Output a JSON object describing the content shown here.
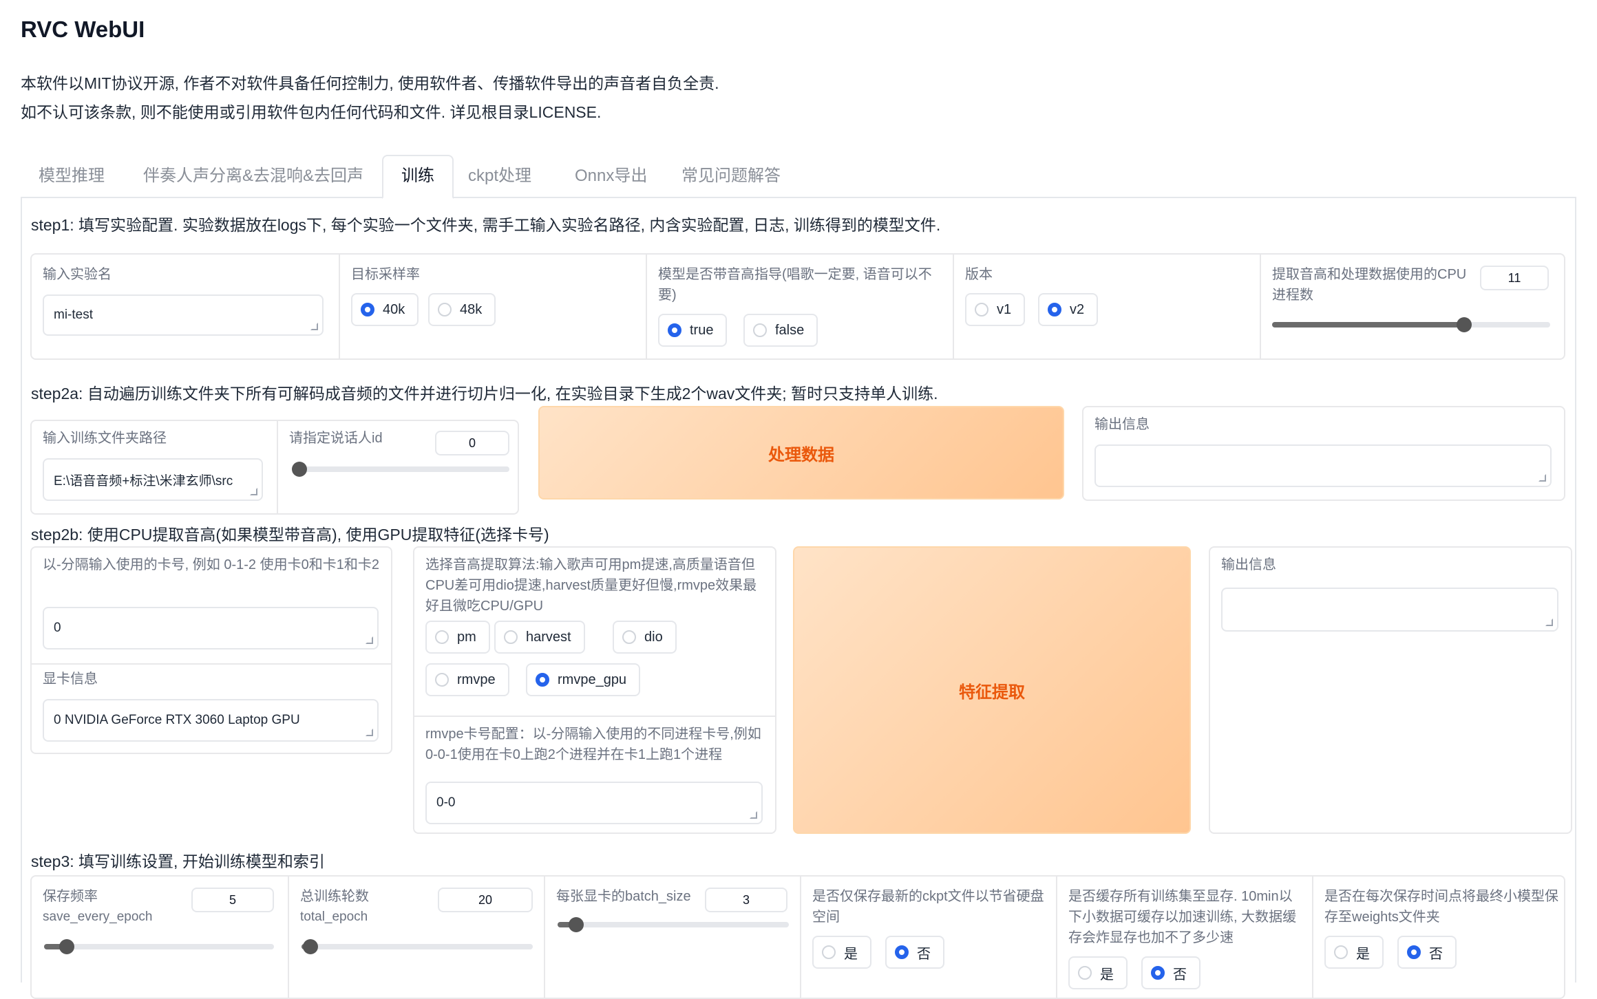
{
  "app": {
    "title": "RVC WebUI",
    "notice": [
      "本软件以MIT协议开源, 作者不对软件具备任何控制力, 使用软件者、传播软件导出的声音者自负全责.",
      "如不认可该条款, 则不能使用或引用软件包内任何代码和文件. 详见根目录LICENSE."
    ]
  },
  "tabs": [
    "模型推理",
    "伴奏人声分离&去混响&去回声",
    "训练",
    "ckpt处理",
    "Onnx导出",
    "常见问题解答"
  ],
  "active_tab": "训练",
  "step1": {
    "heading": "step1: 填写实验配置. 实验数据放在logs下, 每个实验一个文件夹, 需手工输入实验名路径, 内含实验配置, 日志, 训练得到的模型文件.",
    "exp_name_label": "输入实验名",
    "exp_name_value": "mi-test",
    "sr_label": "目标采样率",
    "sr_options": [
      "40k",
      "48k"
    ],
    "sr_selected": "40k",
    "f0_label": "模型是否带音高指导(唱歌一定要, 语音可以不要)",
    "f0_options": [
      "true",
      "false"
    ],
    "f0_selected": "true",
    "version_label": "版本",
    "version_options": [
      "v1",
      "v2"
    ],
    "version_selected": "v2",
    "cpu_label": "提取音高和处理数据使用的CPU进程数",
    "cpu_value": "11",
    "cpu_fraction": 0.69
  },
  "step2a": {
    "heading": "step2a: 自动遍历训练文件夹下所有可解码成音频的文件并进行切片归一化, 在实验目录下生成2个wav文件夹; 暂时只支持单人训练.",
    "folder_label": "输入训练文件夹路径",
    "folder_value": "E:\\语音音频+标注\\米津玄师\\src",
    "speaker_label": "请指定说话人id",
    "speaker_value": "0",
    "speaker_fraction": 0.0,
    "process_button": "处理数据",
    "output_label": "输出信息",
    "output_value": ""
  },
  "step2b": {
    "heading": "step2b: 使用CPU提取音高(如果模型带音高), 使用GPU提取特征(选择卡号)",
    "gpus_label": "以-分隔输入使用的卡号, 例如 0-1-2 使用卡0和卡1和卡2",
    "gpus_value": "0",
    "gpu_info_label": "显卡信息",
    "gpu_info_value": "0  NVIDIA GeForce RTX 3060 Laptop GPU",
    "f0_method_label": "选择音高提取算法:输入歌声可用pm提速,高质量语音但CPU差可用dio提速,harvest质量更好但慢,rmvpe效果最好且微吃CPU/GPU",
    "f0_methods": [
      "pm",
      "harvest",
      "dio",
      "rmvpe",
      "rmvpe_gpu"
    ],
    "f0_method_selected": "rmvpe_gpu",
    "rmvpe_label": "rmvpe卡号配置：以-分隔输入使用的不同进程卡号,例如0-0-1使用在卡0上跑2个进程并在卡1上跑1个进程",
    "rmvpe_value": "0-0",
    "extract_button": "特征提取",
    "output_label": "输出信息",
    "output_value": ""
  },
  "step3": {
    "heading": "step3: 填写训练设置, 开始训练模型和索引",
    "save_freq_label": "保存频率",
    "save_freq_sub": "save_every_epoch",
    "save_freq_value": "5",
    "save_freq_fraction": 0.1,
    "epochs_label": "总训练轮数",
    "epochs_sub": "total_epoch",
    "epochs_value": "20",
    "epochs_fraction": 0.04,
    "batch_label": "每张显卡的batch_size",
    "batch_value": "3",
    "batch_fraction": 0.08,
    "latest_label": "是否仅保存最新的ckpt文件以节省硬盘空间",
    "latest_options": [
      "是",
      "否"
    ],
    "latest_selected": "否",
    "cache_label": "是否缓存所有训练集至显存. 10min以下小数据可缓存以加速训练, 大数据缓存会炸显存也加不了多少速",
    "cache_options": [
      "是",
      "否"
    ],
    "cache_selected": "否",
    "weights_label": "是否在每次保存时间点将最终小模型保存至weights文件夹",
    "weights_options": [
      "是",
      "否"
    ],
    "weights_selected": "否"
  }
}
